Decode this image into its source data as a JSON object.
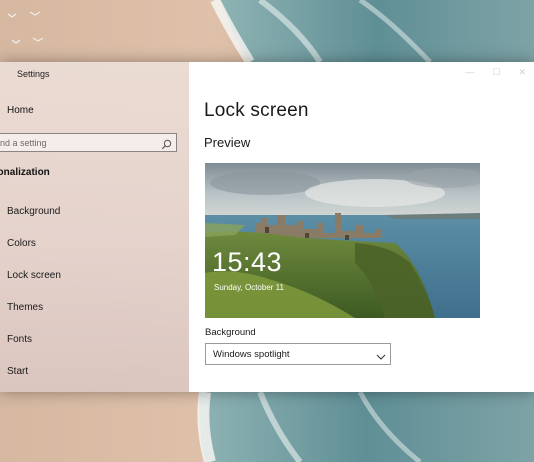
{
  "window": {
    "title": "Settings",
    "controls": [
      "—",
      "☐",
      "✕"
    ]
  },
  "sidebar": {
    "home_label": "Home",
    "search_placeholder": "ind a setting",
    "section_title": "sonalization",
    "items": [
      {
        "label": "Background"
      },
      {
        "label": "Colors"
      },
      {
        "label": "Lock screen"
      },
      {
        "label": "Themes"
      },
      {
        "label": "Fonts"
      },
      {
        "label": "Start"
      }
    ]
  },
  "main": {
    "page_title": "Lock screen",
    "preview_heading": "Preview",
    "preview": {
      "time": "15:43",
      "date": "Sunday, October 11"
    },
    "background_label": "Background",
    "background_selected": "Windows spotlight"
  },
  "colors": {
    "content_bg": "#ffffff",
    "sidebar_tint": "#e5d4ce"
  },
  "icons": {
    "search": "search-icon",
    "dropdown": "chevron-down-icon"
  }
}
